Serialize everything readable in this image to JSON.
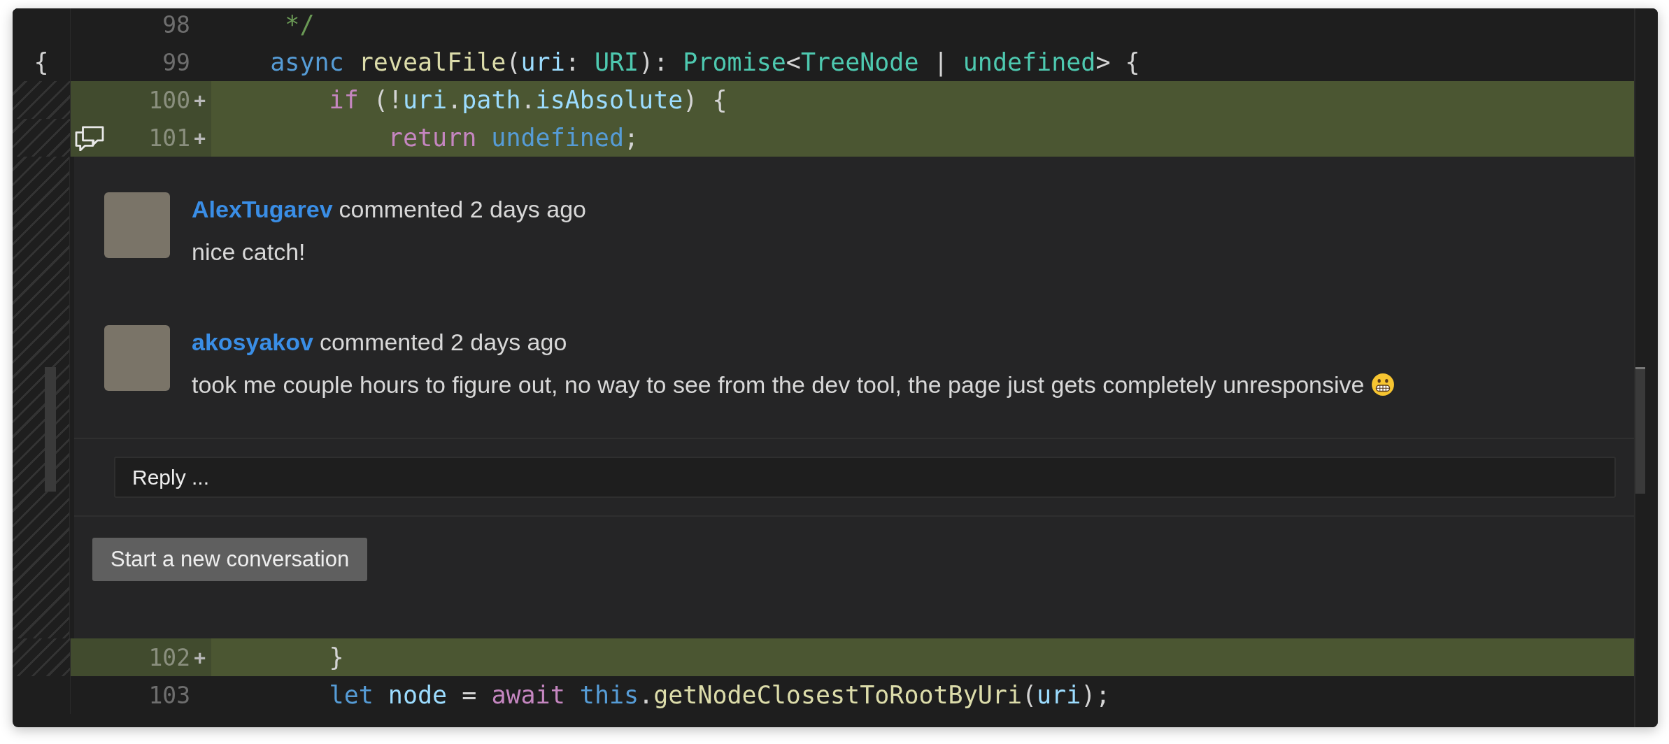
{
  "editor": {
    "lines_before": [
      {
        "number": "98",
        "added": false,
        "has_comment": false,
        "tokens": [
          {
            "kind": "comment",
            "text": "     */"
          }
        ]
      },
      {
        "number": "99",
        "added": false,
        "margin_glyph": "{",
        "has_comment": false,
        "tokens": [
          {
            "kind": "keyword",
            "text": "    async"
          },
          {
            "kind": "function",
            "text": " revealFile"
          },
          {
            "kind": "plain",
            "text": "("
          },
          {
            "kind": "variable",
            "text": "uri"
          },
          {
            "kind": "plain",
            "text": ": "
          },
          {
            "kind": "type",
            "text": "URI"
          },
          {
            "kind": "plain",
            "text": "): "
          },
          {
            "kind": "type",
            "text": "Promise"
          },
          {
            "kind": "plain",
            "text": "<"
          },
          {
            "kind": "type",
            "text": "TreeNode"
          },
          {
            "kind": "plain",
            "text": " | "
          },
          {
            "kind": "type",
            "text": "undefined"
          },
          {
            "kind": "plain",
            "text": "> {"
          }
        ]
      },
      {
        "number": "100",
        "added": true,
        "diff_mark": "+",
        "has_comment": false,
        "tokens": [
          {
            "kind": "control",
            "text": "        if"
          },
          {
            "kind": "plain",
            "text": " (!"
          },
          {
            "kind": "variable",
            "text": "uri"
          },
          {
            "kind": "plain",
            "text": "."
          },
          {
            "kind": "variable",
            "text": "path"
          },
          {
            "kind": "plain",
            "text": "."
          },
          {
            "kind": "variable",
            "text": "isAbsolute"
          },
          {
            "kind": "plain",
            "text": ") {"
          }
        ]
      },
      {
        "number": "101",
        "added": true,
        "diff_mark": "+",
        "has_comment": true,
        "tokens": [
          {
            "kind": "control",
            "text": "            return"
          },
          {
            "kind": "keyword",
            "text": " undefined"
          },
          {
            "kind": "plain",
            "text": ";"
          }
        ]
      }
    ],
    "comment_thread": {
      "comments": [
        {
          "author": "AlexTugarev",
          "meta": "commented 2 days ago",
          "body": "nice catch!",
          "kind": "plain"
        },
        {
          "author": "akosyakov",
          "meta": "commented 2 days ago",
          "body": "took me couple hours to figure out, no way to see from the dev tool, the page just gets completely unresponsive",
          "kind": "with_emoji"
        }
      ],
      "reply": {
        "placeholder": "Reply ..."
      },
      "new_conversation_button": "Start a new conversation"
    },
    "lines_after": [
      {
        "number": "102",
        "added": true,
        "diff_mark": "+",
        "has_comment": false,
        "tokens": [
          {
            "kind": "plain",
            "text": "        }"
          }
        ]
      },
      {
        "number": "103",
        "added": false,
        "has_comment": false,
        "tokens": [
          {
            "kind": "keyword",
            "text": "        let"
          },
          {
            "kind": "variable",
            "text": " node"
          },
          {
            "kind": "plain",
            "text": " = "
          },
          {
            "kind": "control",
            "text": "await"
          },
          {
            "kind": "keyword",
            "text": " this"
          },
          {
            "kind": "plain",
            "text": "."
          },
          {
            "kind": "function",
            "text": "getNodeClosestToRootByUri"
          },
          {
            "kind": "plain",
            "text": "("
          },
          {
            "kind": "variable",
            "text": "uri"
          },
          {
            "kind": "plain",
            "text": ");"
          }
        ]
      }
    ]
  }
}
